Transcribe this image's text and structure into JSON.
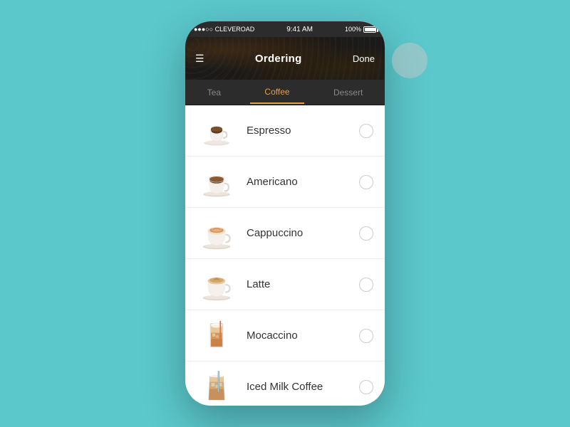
{
  "status_bar": {
    "carrier": "●●●○○ CLEVEROAD",
    "time": "9:41 AM",
    "battery": "100%"
  },
  "header": {
    "menu_icon": "☰",
    "title": "Ordering",
    "done_label": "Done"
  },
  "tabs": [
    {
      "id": "tea",
      "label": "Tea",
      "active": false
    },
    {
      "id": "coffee",
      "label": "Coffee",
      "active": true
    },
    {
      "id": "dessert",
      "label": "Dessert",
      "active": false
    }
  ],
  "items": [
    {
      "id": "espresso",
      "name": "Espresso",
      "selected": false
    },
    {
      "id": "americano",
      "name": "Americano",
      "selected": false
    },
    {
      "id": "cappuccino",
      "name": "Cappuccino",
      "selected": false
    },
    {
      "id": "latte",
      "name": "Latte",
      "selected": false
    },
    {
      "id": "mocaccino",
      "name": "Mocaccino",
      "selected": false
    },
    {
      "id": "iced-milk-coffee",
      "name": "Iced Milk Coffee",
      "selected": false
    }
  ],
  "colors": {
    "accent": "#e8a040",
    "background": "#5bc8cc",
    "header_bg": "#1a1a1a",
    "tab_bg": "#2c2c2c"
  }
}
